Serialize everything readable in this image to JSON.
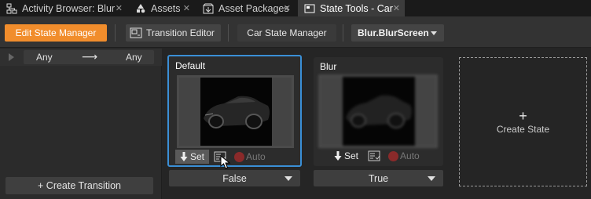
{
  "tabs": [
    {
      "label": "Activity Browser: Blur",
      "icon": "activity-browser-icon",
      "active": false
    },
    {
      "label": "Assets",
      "icon": "assets-icon",
      "active": false
    },
    {
      "label": "Asset Packages",
      "icon": "asset-packages-icon",
      "active": false
    },
    {
      "label": "State Tools - Car",
      "icon": "state-tools-icon",
      "active": true
    }
  ],
  "tab_close_glyph": "✕",
  "toolbar": {
    "edit_state_manager": "Edit State Manager",
    "transition_editor": "Transition Editor",
    "car_state_manager": "Car State Manager",
    "state_selector": "Blur.BlurScreen"
  },
  "transitions": {
    "from": "Any",
    "arrow": "⟶",
    "to": "Any",
    "create_label": "+ Create Transition"
  },
  "states": [
    {
      "title": "Default",
      "set_label": "Set",
      "auto_label": "Auto",
      "value": "False",
      "selected": true
    },
    {
      "title": "Blur",
      "set_label": "Set",
      "auto_label": "Auto",
      "value": "True",
      "selected": false
    }
  ],
  "create_state": {
    "plus": "+",
    "label": "Create State"
  },
  "colors": {
    "accent": "#f18d2c",
    "selection": "#3a8fd6",
    "background": "#252525"
  }
}
